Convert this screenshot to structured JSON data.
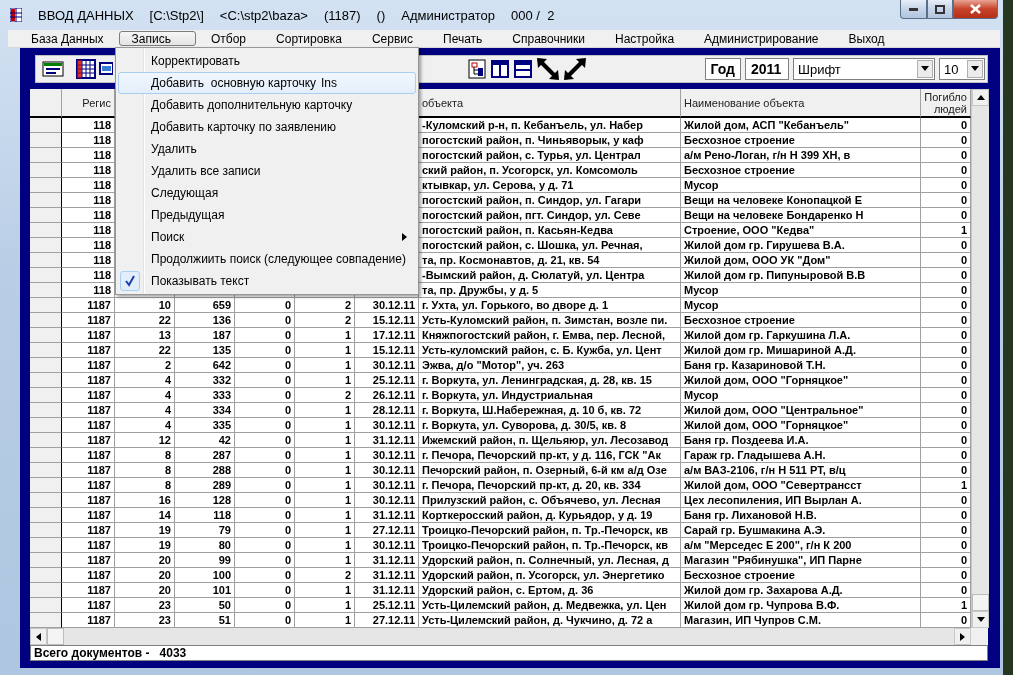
{
  "window": {
    "title_parts": [
      "ВВОД ДАННЫХ",
      "[C:\\Stp2\\]",
      "<C:\\stp2\\baza>",
      "(1187)",
      "()",
      "Администратор",
      "000 /  2"
    ]
  },
  "menu_bar": [
    {
      "label": "База Данных",
      "selected": false
    },
    {
      "label": "Запись",
      "selected": true
    },
    {
      "label": "Отбор",
      "selected": false
    },
    {
      "label": "Сортировка",
      "selected": false
    },
    {
      "label": "Сервис",
      "selected": false
    },
    {
      "label": "Печать",
      "selected": false
    },
    {
      "label": "Справочники",
      "selected": false
    },
    {
      "label": "Настройка",
      "selected": false
    },
    {
      "label": "Администрирование",
      "selected": false
    },
    {
      "label": "Выход",
      "selected": false
    }
  ],
  "toolbar": {
    "year_label": "Год",
    "year": "2011",
    "font": "Шрифт",
    "font_size": "10"
  },
  "open_menu": [
    {
      "label": "Корректировать",
      "highlighted": false,
      "checked": false,
      "submenu": false
    },
    {
      "label": "Добавить  основную карточку",
      "shortcut": "Ins",
      "highlighted": true,
      "checked": false,
      "submenu": false
    },
    {
      "label": "Добавить дополнительную карточку",
      "highlighted": false,
      "checked": false,
      "submenu": false
    },
    {
      "label": "Добавить карточку по заявлению",
      "highlighted": false,
      "checked": false,
      "submenu": false
    },
    {
      "label": "Удалить",
      "highlighted": false,
      "checked": false,
      "submenu": false
    },
    {
      "label": "Удалить все записи",
      "highlighted": false,
      "checked": false,
      "submenu": false
    },
    {
      "label": "Следующая",
      "highlighted": false,
      "checked": false,
      "submenu": false
    },
    {
      "label": "Предыдущая",
      "highlighted": false,
      "checked": false,
      "submenu": false
    },
    {
      "label": "Поиск",
      "highlighted": false,
      "checked": false,
      "submenu": true
    },
    {
      "label": "Продолжиить поиск (следующее совпадение)",
      "highlighted": false,
      "checked": false,
      "submenu": false
    },
    {
      "label": "Показывать текст",
      "highlighted": false,
      "checked": true,
      "submenu": false
    }
  ],
  "table": {
    "header": {
      "column_1": "Регис",
      "column_7": "объекта",
      "column_8": "Наименование объекта",
      "column_9": "Погибло людей"
    },
    "rows": [
      {
        "column_1": "118",
        "column_7": "-Куломский р-н, п. Кебанъель, ул. Набер",
        "column_8": "Жилой дом, АСП \"Кебанъель\"",
        "column_9": "0"
      },
      {
        "column_1": "118",
        "column_7": "погостский район, п. Чиньяворык, у каф",
        "column_8": "Бесхозное строение",
        "column_9": "0"
      },
      {
        "column_1": "118",
        "column_7": "погостский район, с. Турья, ул. Централ",
        "column_8": "а/м Рено-Логан, г/н Н 399 ХН, в",
        "column_9": "0"
      },
      {
        "column_1": "118",
        "column_7": "ский район, п. Усогорск, ул. Комсомоль",
        "column_8": "Бесхозное строение",
        "column_9": "0"
      },
      {
        "column_1": "118",
        "column_7": "ктывкар, ул. Серова, у д. 71",
        "column_8": "Мусор",
        "column_9": "0"
      },
      {
        "column_1": "118",
        "column_7": "погостский район, п. Синдор, ул. Гагари",
        "column_8": "Вещи на человеке Конопацкой Е",
        "column_9": "0"
      },
      {
        "column_1": "118",
        "column_7": "погостский район, пгт. Синдор, ул. Севе",
        "column_8": "Вещи на человеке Бондаренко Н",
        "column_9": "0"
      },
      {
        "column_1": "118",
        "column_7": "погостский район, п. Касьян-Кедва",
        "column_8": "Строение, ООО \"Кедва\"",
        "column_9": "1"
      },
      {
        "column_1": "118",
        "column_7": "погостский район, с. Шошка, ул. Речная,",
        "column_8": "Жилой дом гр. Гирушева В.А.",
        "column_9": "0"
      },
      {
        "column_1": "118",
        "column_7": "та, пр. Космонавтов, д. 21, кв. 54",
        "column_8": "Жилой дом, ООО УК \"Дом\"",
        "column_9": "0"
      },
      {
        "column_1": "118",
        "column_7": "-Вымский район, д. Сюлатуй, ул. Центра",
        "column_8": "Жилой дом гр. Пипуныровой В.В",
        "column_9": "0"
      },
      {
        "column_1": "118",
        "column_7": "та, пр. Дружбы, у д. 5",
        "column_8": "Мусор",
        "column_9": "0"
      },
      {
        "column_1": "1187",
        "column_2": "10",
        "column_3": "659",
        "column_4": "0",
        "column_5": "2",
        "column_6": "30.12.11",
        "column_7": "г. Ухта, ул. Горького, во дворе д. 1",
        "column_8": "Мусор",
        "column_9": "0"
      },
      {
        "column_1": "1187",
        "column_2": "22",
        "column_3": "136",
        "column_4": "0",
        "column_5": "2",
        "column_6": "15.12.11",
        "column_7": "Усть-Куломский район, п. Зимстан, возле пи.",
        "column_8": "Бесхозное строение",
        "column_9": "0"
      },
      {
        "column_1": "1187",
        "column_2": "13",
        "column_3": "187",
        "column_4": "0",
        "column_5": "1",
        "column_6": "17.12.11",
        "column_7": "Княжпогостский район, г. Емва, пер. Лесной,",
        "column_8": "Жилой дом гр. Гаркушина Л.А.",
        "column_9": "0"
      },
      {
        "column_1": "1187",
        "column_2": "22",
        "column_3": "135",
        "column_4": "0",
        "column_5": "1",
        "column_6": "15.12.11",
        "column_7": "Усть-куломский район, с. Б. Кужба, ул. Цент",
        "column_8": "Жилой дом гр. Мишариной А.Д.",
        "column_9": "0"
      },
      {
        "column_1": "1187",
        "column_2": "2",
        "column_3": "642",
        "column_4": "0",
        "column_5": "1",
        "column_6": "30.12.11",
        "column_7": "Эжва, д/о \"Мотор\", уч. 263",
        "column_8": "Баня гр. Казариновой Т.Н.",
        "column_9": "0"
      },
      {
        "column_1": "1187",
        "column_2": "4",
        "column_3": "332",
        "column_4": "0",
        "column_5": "1",
        "column_6": "25.12.11",
        "column_7": "г. Воркута, ул. Ленинградская, д. 28, кв. 15",
        "column_8": "Жилой дом, ООО \"Горняцкое\"",
        "column_9": "0"
      },
      {
        "column_1": "1187",
        "column_2": "4",
        "column_3": "333",
        "column_4": "0",
        "column_5": "2",
        "column_6": "26.12.11",
        "column_7": "г. Воркута, ул. Индустриальная",
        "column_8": "Мусор",
        "column_9": "0"
      },
      {
        "column_1": "1187",
        "column_2": "4",
        "column_3": "334",
        "column_4": "0",
        "column_5": "1",
        "column_6": "28.12.11",
        "column_7": "г. Воркута, Ш.Набережная, д. 10 б, кв. 72",
        "column_8": "Жилой дом, ООО \"Центральное\"",
        "column_9": "0"
      },
      {
        "column_1": "1187",
        "column_2": "4",
        "column_3": "335",
        "column_4": "0",
        "column_5": "1",
        "column_6": "30.12.11",
        "column_7": "г. Воркута, ул. Суворова, д. 30/5, кв. 8",
        "column_8": "Жилой дом, ООО \"Горняцкое\"",
        "column_9": "0"
      },
      {
        "column_1": "1187",
        "column_2": "12",
        "column_3": "42",
        "column_4": "0",
        "column_5": "1",
        "column_6": "31.12.11",
        "column_7": "Ижемский район, п. Щельяюр, ул. Лесозавод",
        "column_8": "Баня гр. Поздеева И.А.",
        "column_9": "0"
      },
      {
        "column_1": "1187",
        "column_2": "8",
        "column_3": "287",
        "column_4": "0",
        "column_5": "1",
        "column_6": "30.12.11",
        "column_7": "г. Печора, Печорский пр-кт, у д. 116, ГСК \"Ак",
        "column_8": "Гараж гр. Гладышева А.Н.",
        "column_9": "0"
      },
      {
        "column_1": "1187",
        "column_2": "8",
        "column_3": "288",
        "column_4": "0",
        "column_5": "1",
        "column_6": "30.12.11",
        "column_7": "Печорский район, п. Озерный, 6-й км а/д Озе",
        "column_8": "а/м ВАЗ-2106, г/н Н 511 РТ, в/ц",
        "column_9": "0"
      },
      {
        "column_1": "1187",
        "column_2": "8",
        "column_3": "289",
        "column_4": "0",
        "column_5": "1",
        "column_6": "30.12.11",
        "column_7": "г. Печора, Печорский пр-кт, д. 20, кв. 334",
        "column_8": "Жилой дом, ООО \"Севертрансст",
        "column_9": "1"
      },
      {
        "column_1": "1187",
        "column_2": "16",
        "column_3": "128",
        "column_4": "0",
        "column_5": "1",
        "column_6": "30.12.11",
        "column_7": "Прилузский район, с. Объячево, ул. Лесная",
        "column_8": "Цех лесопиления, ИП Вырлан А.",
        "column_9": "0"
      },
      {
        "column_1": "1187",
        "column_2": "14",
        "column_3": "118",
        "column_4": "0",
        "column_5": "1",
        "column_6": "31.12.11",
        "column_7": "Корткеросский район, д. Курьядор, у д. 19",
        "column_8": "Баня гр. Лихановой Н.В.",
        "column_9": "0"
      },
      {
        "column_1": "1187",
        "column_2": "19",
        "column_3": "79",
        "column_4": "0",
        "column_5": "1",
        "column_6": "27.12.11",
        "column_7": "Троицко-Печорский район, п. Тр.-Печорск, кв",
        "column_8": "Сарай гр. Бушмакина А.Э.",
        "column_9": "0"
      },
      {
        "column_1": "1187",
        "column_2": "19",
        "column_3": "80",
        "column_4": "0",
        "column_5": "1",
        "column_6": "30.12.11",
        "column_7": "Троицко-Печорский район, п. Тр.-Печорск, кв",
        "column_8": "а/м \"Мерседес Е 200\", г/н К 200",
        "column_9": "0"
      },
      {
        "column_1": "1187",
        "column_2": "20",
        "column_3": "99",
        "column_4": "0",
        "column_5": "1",
        "column_6": "31.12.11",
        "column_7": "Удорский район, п. Солнечный, ул. Лесная, д",
        "column_8": "Магазин \"Рябинушка\", ИП Парне",
        "column_9": "0"
      },
      {
        "column_1": "1187",
        "column_2": "20",
        "column_3": "100",
        "column_4": "0",
        "column_5": "2",
        "column_6": "31.12.11",
        "column_7": "Удорский район, п. Усогорск, ул. Энергетико",
        "column_8": "Бесхозное строение",
        "column_9": "0"
      },
      {
        "column_1": "1187",
        "column_2": "20",
        "column_3": "101",
        "column_4": "0",
        "column_5": "1",
        "column_6": "31.12.11",
        "column_7": "Удорский район, с. Ертом, д. 36",
        "column_8": "Жилой дом гр. Захарова А.Д.",
        "column_9": "0"
      },
      {
        "column_1": "1187",
        "column_2": "23",
        "column_3": "50",
        "column_4": "0",
        "column_5": "1",
        "column_6": "25.12.11",
        "column_7": "Усть-Цилемский район, д. Медвежка, ул. Цен",
        "column_8": "Жилой дом гр. Чупрова В.Ф.",
        "column_9": "1"
      },
      {
        "column_1": "1187",
        "column_2": "23",
        "column_3": "51",
        "column_4": "0",
        "column_5": "1",
        "column_6": "27.12.11",
        "column_7": "Усть-Цилемский район, д. Чукчино, д. 72 а",
        "column_8": "Магазин, ИП Чупров С.М.",
        "column_9": "0"
      }
    ]
  },
  "status_bar": "Всего документов -   4033"
}
